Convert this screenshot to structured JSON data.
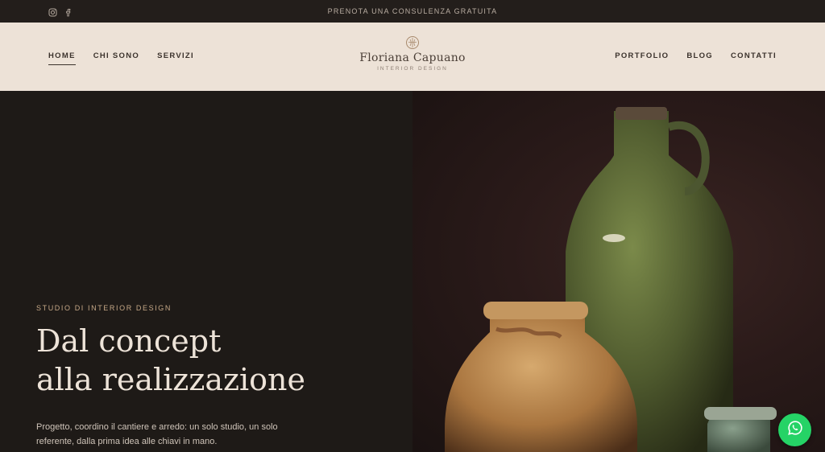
{
  "topbar": {
    "social_icons": [
      "instagram-icon",
      "facebook-icon"
    ],
    "announcement": "PRENOTA UNA CONSULENZA GRATUITA"
  },
  "header": {
    "nav_left": [
      {
        "label": "HOME",
        "active": true
      },
      {
        "label": "CHI SONO",
        "active": false
      },
      {
        "label": "SERVIZI",
        "active": false
      }
    ],
    "nav_right": [
      {
        "label": "PORTFOLIO"
      },
      {
        "label": "BLOG"
      },
      {
        "label": "CONTATTI"
      }
    ],
    "logo": {
      "icon": "logo-mark-icon",
      "name": "Floriana Capuano",
      "tagline": "INTERIOR DESIGN"
    }
  },
  "hero": {
    "eyebrow": "STUDIO DI INTERIOR DESIGN",
    "headline_line1": "Dal concept",
    "headline_line2": "alla realizzazione",
    "lead": "Progetto, coordino il cantiere e arredo: un solo studio, un solo referente, dalla prima idea alle chiavi in mano.",
    "image": "ceramic-vases-photo"
  },
  "floating": {
    "whatsapp_icon": "whatsapp-icon"
  },
  "colors": {
    "topbar_bg": "#231e1b",
    "header_bg": "#ede2d7",
    "hero_bg": "#1e1a17",
    "eyebrow": "#c6a887",
    "headline": "#ede3d8",
    "whatsapp": "#25d366"
  }
}
